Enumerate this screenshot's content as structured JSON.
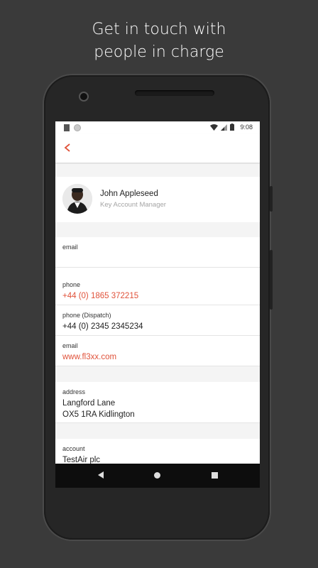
{
  "headline": {
    "line1": "Get in touch with",
    "line2": "people in charge"
  },
  "statusbar": {
    "time": "9:08"
  },
  "colors": {
    "accent": "#e0523a"
  },
  "icons": {
    "back": "chevron-left-icon"
  },
  "profile": {
    "name": "John Appleseed",
    "role": "Key Account Manager"
  },
  "fields": [
    {
      "label": "email",
      "value": ""
    },
    {
      "label": "phone",
      "value": "+44 (0) 1865 372215"
    },
    {
      "label": "phone (Dispatch)",
      "value": "+44 (0) 2345 2345234"
    },
    {
      "label": "email",
      "value": "www.fl3xx.com"
    },
    {
      "label": "address",
      "line1": "Langford Lane",
      "line2": "OX5 1RA Kidlington"
    },
    {
      "label": "account",
      "value": "TestAir plc"
    }
  ]
}
